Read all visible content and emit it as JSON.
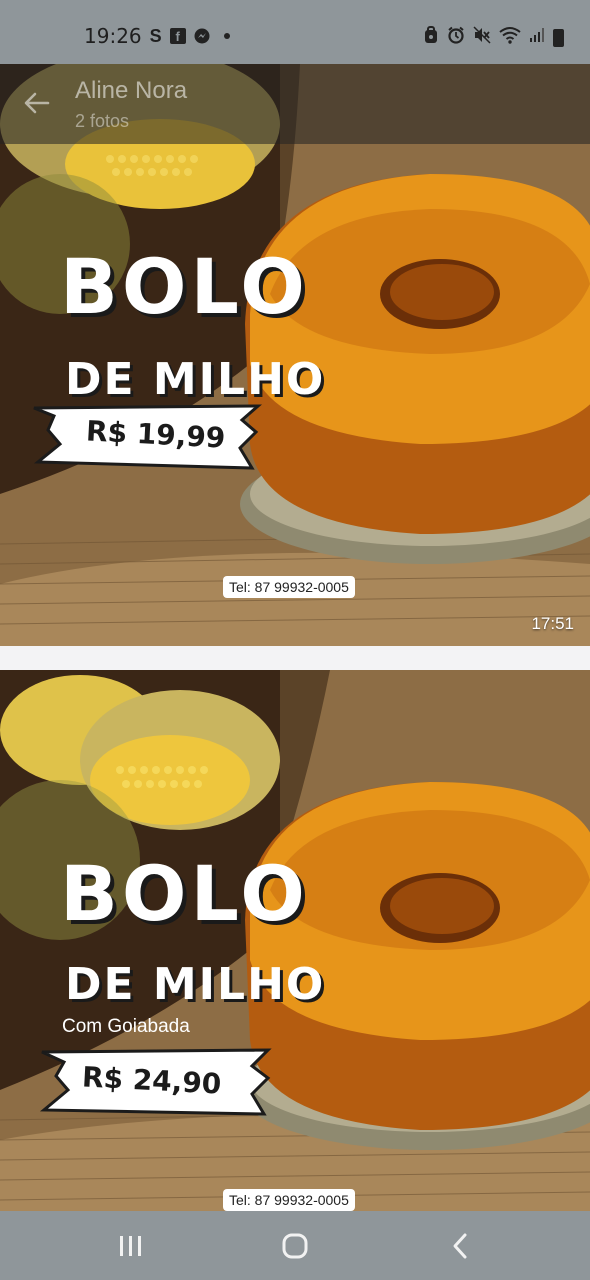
{
  "status_bar": {
    "time": "19:26",
    "icons": [
      "s-app-icon",
      "facebook-icon",
      "messenger-icon",
      "notification-dot",
      "alarm-lock-icon",
      "alarm-icon",
      "mute-icon",
      "wifi-icon",
      "signal-icon",
      "battery-icon"
    ]
  },
  "header": {
    "title": "Aline Nora",
    "subtitle": "2 fotos"
  },
  "photos": [
    {
      "line1": "BOLO",
      "line2": "DE MILHO",
      "price": "R$ 19,99",
      "tel": "Tel: 87 99932-0005",
      "timestamp": "17:51"
    },
    {
      "line1": "BOLO",
      "line2": "DE MILHO",
      "subtitle": "Com Goiabada",
      "price": "R$ 24,90",
      "tel": "Tel: 87 99932-0005"
    }
  ],
  "nav": [
    "recents-button",
    "home-button",
    "back-button"
  ],
  "colors": {
    "bar_gray": "#8f969a",
    "cake_orange": "#e7951a",
    "burlap": "#a9875a",
    "dark_bg": "#3b2716"
  }
}
